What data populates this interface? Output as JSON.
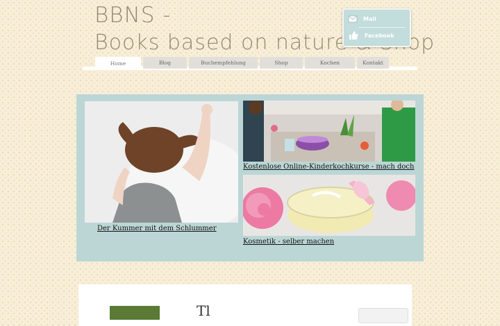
{
  "header": {
    "logo_line1": "BBNS -",
    "logo_line2": "Books based on nature & Shop"
  },
  "social": {
    "mail": {
      "label": "Mail",
      "icon": "envelope-icon"
    },
    "facebook": {
      "label": "Facebook",
      "icon": "thumbs-up-icon"
    }
  },
  "nav": {
    "active": "Home",
    "items": [
      "Home",
      "Blog",
      "Buchempfehlung",
      "Shop",
      "Kochen",
      "Kontakt"
    ]
  },
  "features": [
    {
      "caption": "Der Kummer mit dem Schlummer"
    },
    {
      "caption": "Kostenlose Online-Kinderkochkurse - mach doch"
    },
    {
      "caption": "Kosmetik - selber machen"
    }
  ],
  "content": {
    "heading_partial": "Tl"
  },
  "colors": {
    "accent": "#bcd6d6",
    "logo": "#8f8a70",
    "background": "#f8efd9"
  }
}
